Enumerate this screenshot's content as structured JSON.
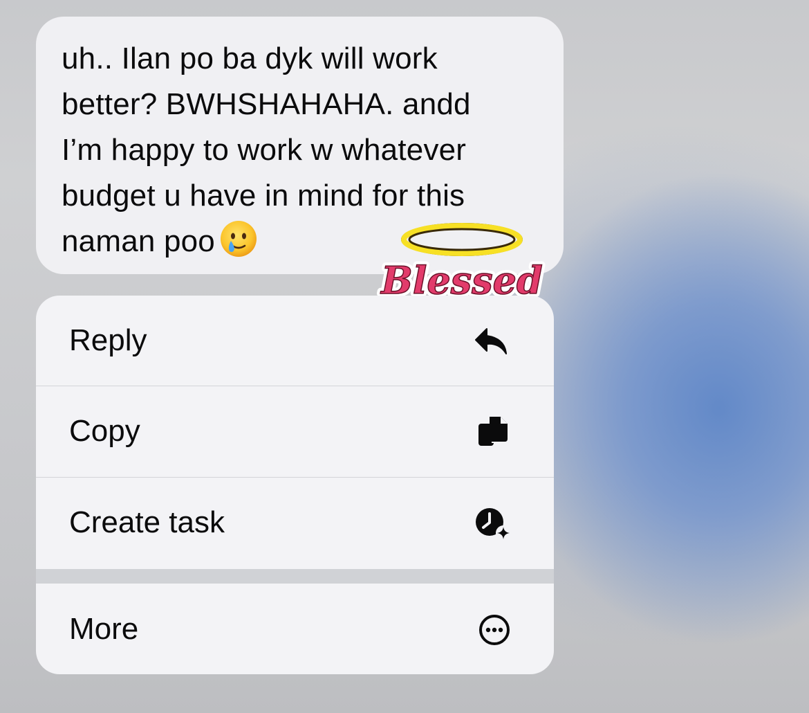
{
  "message": {
    "lines": [
      "uh.. Ilan po ba dyk will work",
      "better? BWHSHAHAHA. andd",
      "I’m happy to work w whatever",
      "budget u have in mind for this",
      "naman poo"
    ],
    "emoji": "face-holding-back-tears",
    "reaction_sticker": "Blessed"
  },
  "menu": {
    "items": [
      {
        "label": "Reply",
        "icon": "reply-arrow-icon"
      },
      {
        "label": "Copy",
        "icon": "copy-documents-icon"
      },
      {
        "label": "Create task",
        "icon": "clock-sparkle-icon"
      },
      {
        "label": "More",
        "icon": "ellipsis-circle-icon"
      }
    ]
  },
  "colors": {
    "sticker_pink": "#e23b6b",
    "halo_yellow": "#f7e025",
    "text": "#0b0b0c"
  }
}
